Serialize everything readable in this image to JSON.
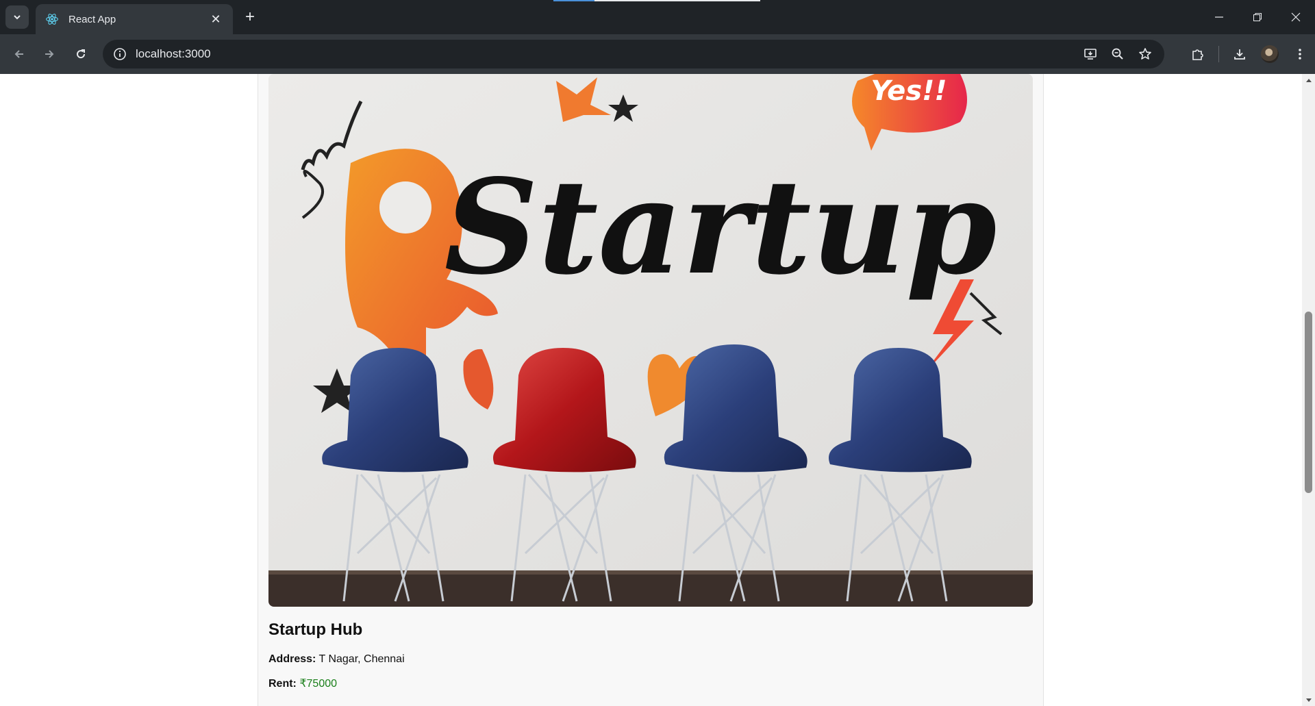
{
  "browser": {
    "tab_title": "React App",
    "url": "localhost:3000",
    "icons": {
      "tab_search": "chevron-down-icon",
      "tab_favicon": "react-icon",
      "tab_close": "close-icon",
      "new_tab": "plus-icon",
      "back": "arrow-left-icon",
      "forward": "arrow-right-icon",
      "reload": "reload-icon",
      "site_info": "info-icon",
      "install": "install-app-icon",
      "zoom": "zoom-out-icon",
      "bookmark": "star-icon",
      "extensions": "puzzle-icon",
      "downloads": "download-icon",
      "menu": "more-vert-icon"
    }
  },
  "listing": {
    "image": {
      "headline": "Startup",
      "bubble_text": "Yes!!"
    },
    "title": "Startup Hub",
    "address_label": "Address:",
    "address_value": "T Nagar, Chennai",
    "rent_label": "Rent:",
    "rent_value": "₹75000"
  },
  "colors": {
    "rent": "#1a7f1a",
    "chrome_dark": "#1f2327",
    "chrome_mid": "#33383d"
  }
}
